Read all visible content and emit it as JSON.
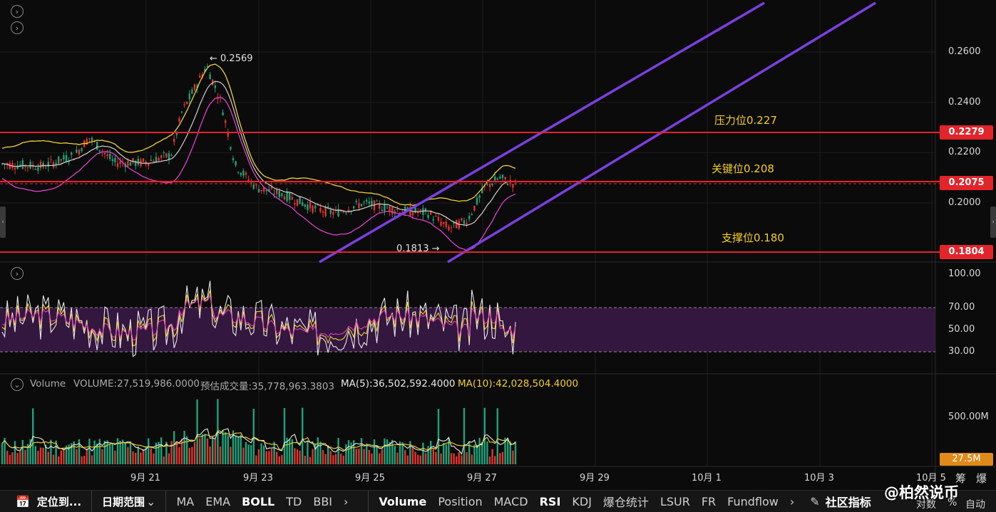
{
  "price_axis": {
    "ticks": [
      "0.2600",
      "0.2400",
      "0.2200",
      "0.2000"
    ],
    "values": [
      0.26,
      0.24,
      0.22,
      0.2
    ]
  },
  "rsi_axis": {
    "ticks": [
      "100.00",
      "70.00",
      "50.00",
      "30.00"
    ]
  },
  "volume_axis": {
    "ticks": [
      "500.00M"
    ],
    "current_label": "27.5M"
  },
  "dates": [
    "9月 21",
    "9月 23",
    "9月 25",
    "9月 27",
    "9月 29",
    "10月 1",
    "10月 3",
    "10月 5"
  ],
  "levels": {
    "resistance": {
      "label": "压力位0.227",
      "pill": "0.2279",
      "value": 0.2279
    },
    "key": {
      "label": "关键位0.208",
      "pill": "0.2075",
      "value": 0.2075
    },
    "support": {
      "label": "支撑位0.180",
      "pill": "0.1804",
      "value": 0.1804
    }
  },
  "annotations": {
    "high": "← 0.2569",
    "low": "0.1813 →"
  },
  "volume_header": {
    "name": "Volume",
    "volume": "VOLUME:27,519,986.0000",
    "estimate": "预估成交量:35,778,963.3803",
    "ma5": "MA(5):36,502,592.4000",
    "ma10": "MA(10):42,028,504.4000"
  },
  "axis_corner": {
    "chip": "筹",
    "blast": "爆",
    "log": "对数",
    "pct": "%",
    "auto": "自动"
  },
  "bottom_bar": {
    "locate": "定位到...",
    "range": "日期范围",
    "indicators_left": [
      "MA",
      "EMA",
      "BOLL",
      "TD",
      "BBI"
    ],
    "indicators_right": [
      "Volume",
      "Position",
      "MACD",
      "RSI",
      "KDJ",
      "爆仓统计",
      "LSUR",
      "FR",
      "Fundflow"
    ],
    "community": "社区指标",
    "watermark": "@柏然说币"
  },
  "colors": {
    "up": "#1fa37a",
    "down": "#e3342f",
    "boll_mid": "#d0d0d0",
    "boll_up": "#f0d23a",
    "boll_low": "#e040c8",
    "channel": "#7b3fe0",
    "level": "#e3242b",
    "rsi_band": "#3b1a48"
  }
}
